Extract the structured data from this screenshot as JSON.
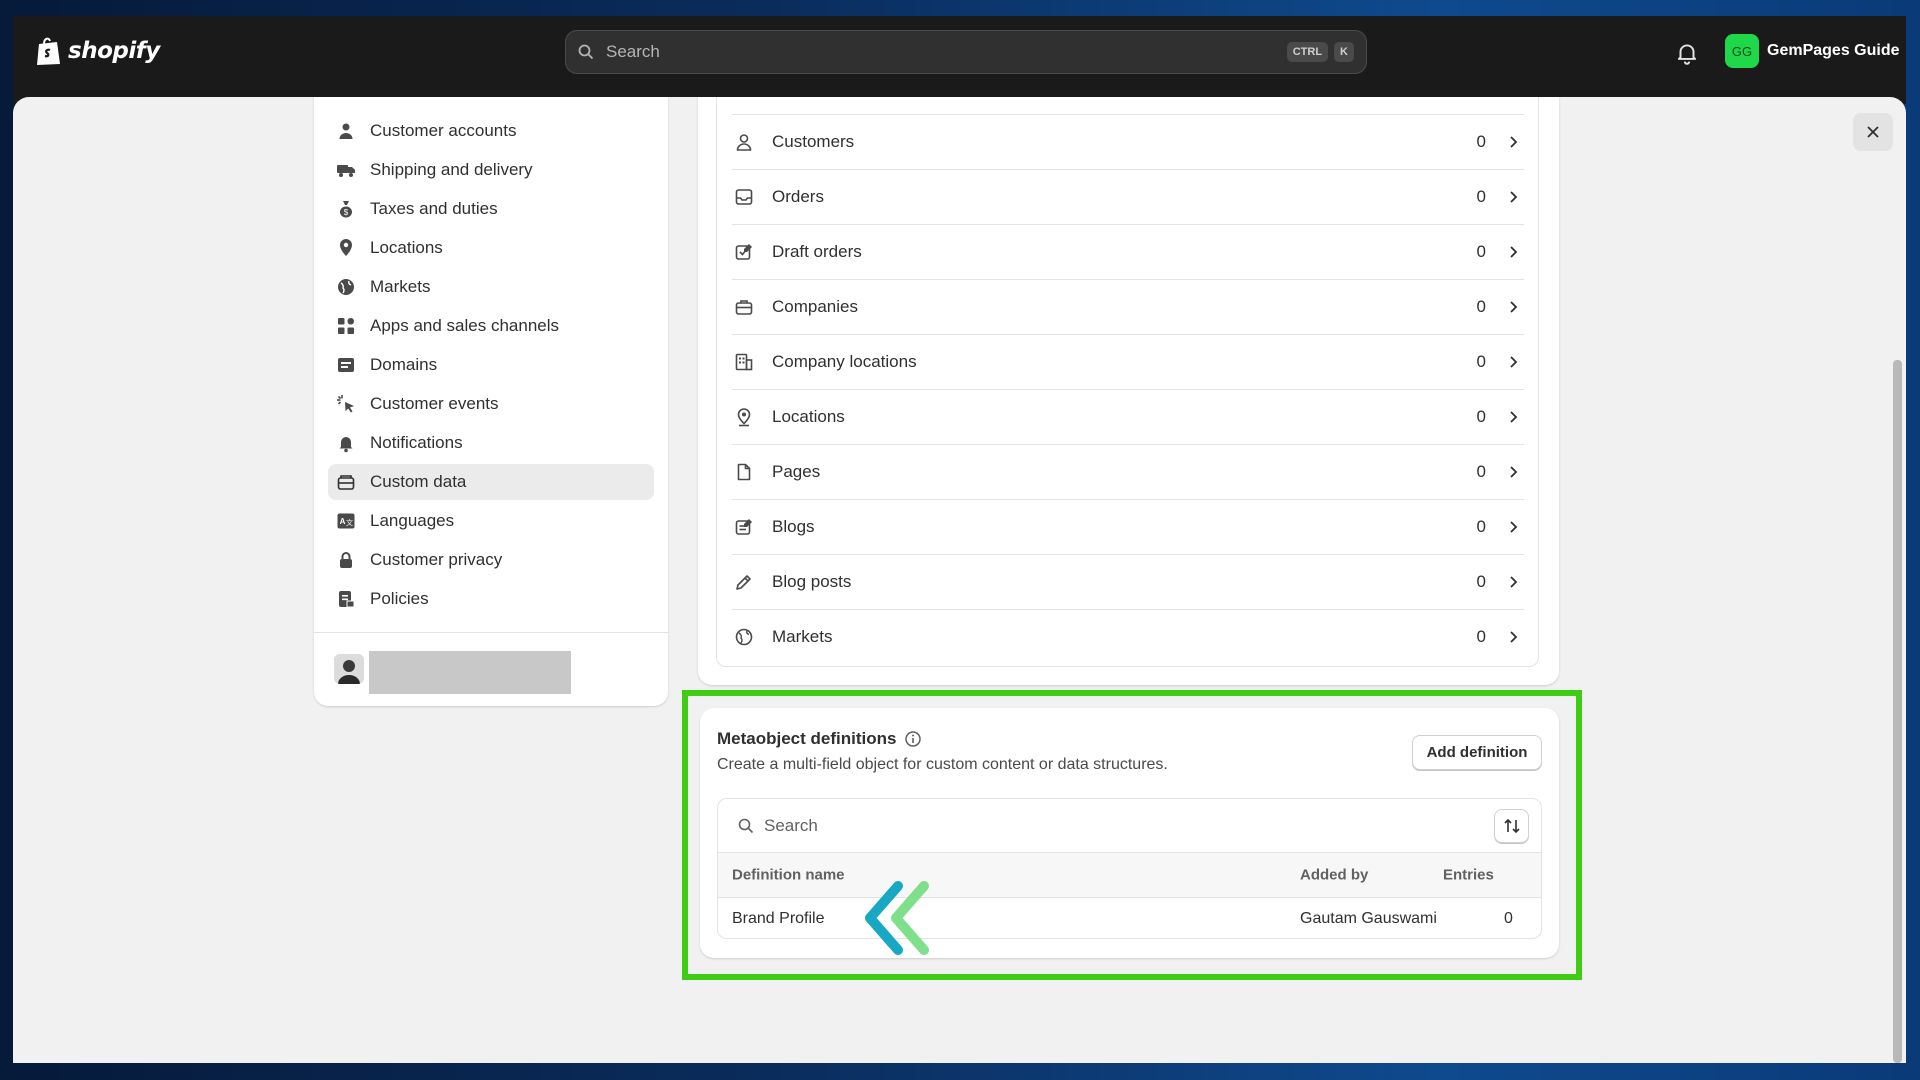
{
  "topbar": {
    "brand": "shopify",
    "search_placeholder": "Search",
    "shortcut_keys": [
      "CTRL",
      "K"
    ],
    "account_initials": "GG",
    "account_name": "GemPages Guide",
    "account_color": "#1fd84a"
  },
  "sidebar": {
    "items": [
      {
        "label": "Customer accounts",
        "icon": "person-icon"
      },
      {
        "label": "Shipping and delivery",
        "icon": "truck-icon"
      },
      {
        "label": "Taxes and duties",
        "icon": "money-bag-icon"
      },
      {
        "label": "Locations",
        "icon": "location-pin-icon"
      },
      {
        "label": "Markets",
        "icon": "globe-icon"
      },
      {
        "label": "Apps and sales channels",
        "icon": "apps-icon"
      },
      {
        "label": "Domains",
        "icon": "domain-icon"
      },
      {
        "label": "Customer events",
        "icon": "cursor-click-icon"
      },
      {
        "label": "Notifications",
        "icon": "bell-icon"
      },
      {
        "label": "Custom data",
        "icon": "custom-data-icon",
        "active": true
      },
      {
        "label": "Languages",
        "icon": "language-icon"
      },
      {
        "label": "Customer privacy",
        "icon": "lock-icon"
      },
      {
        "label": "Policies",
        "icon": "policy-icon"
      }
    ]
  },
  "resources": [
    {
      "label": "Customers",
      "count": "0",
      "icon": "person-icon"
    },
    {
      "label": "Orders",
      "count": "0",
      "icon": "inbox-icon"
    },
    {
      "label": "Draft orders",
      "count": "0",
      "icon": "draft-order-icon"
    },
    {
      "label": "Companies",
      "count": "0",
      "icon": "briefcase-icon"
    },
    {
      "label": "Company locations",
      "count": "0",
      "icon": "building-icon"
    },
    {
      "label": "Locations",
      "count": "0",
      "icon": "location-pin-icon"
    },
    {
      "label": "Pages",
      "count": "0",
      "icon": "page-icon"
    },
    {
      "label": "Blogs",
      "count": "0",
      "icon": "blog-icon"
    },
    {
      "label": "Blog posts",
      "count": "0",
      "icon": "pencil-icon"
    },
    {
      "label": "Markets",
      "count": "0",
      "icon": "globe-icon"
    }
  ],
  "metaobjects": {
    "title": "Metaobject definitions",
    "subtitle": "Create a multi-field object for custom content or data structures.",
    "add_button": "Add definition",
    "search_placeholder": "Search",
    "columns": {
      "name": "Definition name",
      "added_by": "Added by",
      "entries": "Entries"
    },
    "rows": [
      {
        "name": "Brand Profile",
        "added_by": "Gautam Gauswami",
        "entries": "0"
      }
    ],
    "highlight_color": "#3fcc15"
  }
}
